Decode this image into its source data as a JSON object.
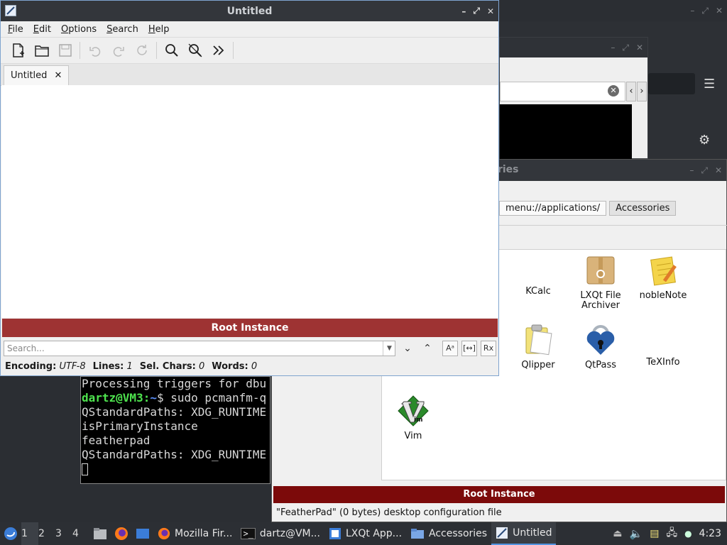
{
  "featherpad": {
    "title": "Untitled",
    "menu": [
      "File",
      "Edit",
      "Options",
      "Search",
      "Help"
    ],
    "tab_label": "Untitled",
    "root_banner": "Root Instance",
    "search_placeholder": "Search...",
    "status": {
      "encoding_label": "Encoding:",
      "encoding_value": "UTF-8",
      "lines_label": "Lines:",
      "lines_value": "1",
      "sel_label": "Sel. Chars:",
      "sel_value": "0",
      "words_label": "Words:",
      "words_value": "0"
    }
  },
  "file_manager": {
    "title_fragment": "sories",
    "path_crumbs": [
      "menu://applications/",
      "Accessories"
    ],
    "items": [
      {
        "label": "KCalc",
        "icon": "kcalc-icon"
      },
      {
        "label": "LXQt File Archiver",
        "icon": "archiver-icon"
      },
      {
        "label": "nobleNote",
        "icon": "noblenote-icon"
      },
      {
        "label": "Qlipper",
        "icon": "qlipper-icon"
      },
      {
        "label": "QtPass",
        "icon": "qtpass-icon"
      },
      {
        "label": "TeXInfo",
        "icon": "texinfo-icon"
      },
      {
        "label": "Vim",
        "icon": "vim-icon"
      }
    ],
    "root_banner": "Root Instance",
    "status": "\"FeatherPad\" (0 bytes) desktop configuration file"
  },
  "terminal": {
    "lines": [
      "Processing triggers for dbu",
      "",
      "QStandardPaths: XDG_RUNTIME",
      "isPrimaryInstance",
      "featherpad",
      "QStandardPaths: XDG_RUNTIME"
    ],
    "prompt_user": "dartz@VM3",
    "prompt_sep": ":",
    "prompt_path": "~",
    "prompt_cmd": "$ sudo pcmanfm-q"
  },
  "taskbar": {
    "desktops": [
      "1",
      "2",
      "3",
      "4"
    ],
    "tasks": [
      {
        "label": "Mozilla Fir...",
        "icon": "firefox-icon"
      },
      {
        "label": "dartz@VM...",
        "icon": "terminal-icon"
      },
      {
        "label": "LXQt App...",
        "icon": "app-icon"
      },
      {
        "label": "Accessories",
        "icon": "folder-icon"
      },
      {
        "label": "Untitled",
        "icon": "featherpad-icon"
      }
    ],
    "clock": "4:23"
  }
}
